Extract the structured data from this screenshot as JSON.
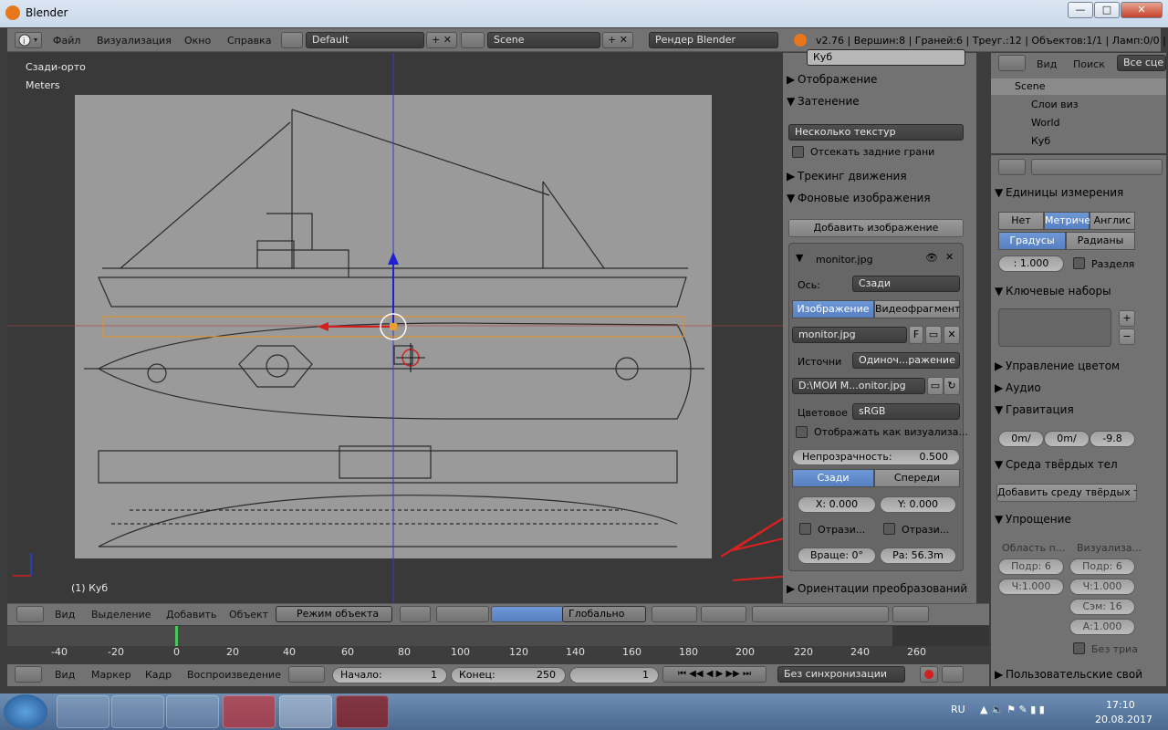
{
  "window": {
    "title": "Blender",
    "min": "—",
    "max": "□",
    "close": "✕"
  },
  "info_header": {
    "menus": [
      "Файл",
      "Визуализация",
      "Окно",
      "Справка"
    ],
    "layout": "Default",
    "scene": "Scene",
    "render_engine": "Рендер Blender",
    "stats": "v2.76 | Вершин:8 | Граней:6 | Треуг.:12 | Объектов:1/1 | Ламп:0/0 | Пам."
  },
  "viewport": {
    "view_name": "Сзади-орто",
    "units": "Meters",
    "object_label": "(1) Куб"
  },
  "viewport_header": {
    "menus": [
      "Вид",
      "Выделение",
      "Добавить",
      "Объект"
    ],
    "mode": "Режим объекта",
    "orientation": "Глобально"
  },
  "timeline": {
    "ticks": [
      "-40",
      "-20",
      "0",
      "20",
      "40",
      "60",
      "80",
      "100",
      "120",
      "140",
      "160",
      "180",
      "200",
      "220",
      "240",
      "260"
    ],
    "menus": [
      "Вид",
      "Маркер",
      "Кадр",
      "Воспроизведение"
    ],
    "start_label": "Начало:",
    "start": "1",
    "end_label": "Конец:",
    "end": "250",
    "current": "1",
    "sync": "Без синхронизации"
  },
  "npanel": {
    "object_name": "Куб",
    "sections": {
      "display": "Отображение",
      "shading": "Затенение",
      "shading_mode": "Несколько текстур",
      "backface": "Отсекать задние грани",
      "motion_tracking": "Трекинг движения",
      "bg_images": "Фоновые изображения",
      "add_image": "Добавить изображение",
      "transform_orient": "Ориентации преобразований"
    },
    "bgimage": {
      "name": "monitor.jpg",
      "axis_label": "Ось:",
      "axis": "Сзади",
      "tab_image": "Изображение",
      "tab_clip": "Видеофрагмент",
      "image_name": "monitor.jpg",
      "fake_user": "F",
      "source_label": "Источни",
      "source": "Одиноч...ражение",
      "path": "D:\\МОИ М...onitor.jpg",
      "color_label": "Цветовое",
      "color_space": "sRGB",
      "show_as_render": "Отображать как визуализа...",
      "opacity": "Непрозрачность:",
      "opacity_value": "0.500",
      "tab_back": "Сзади",
      "tab_front": "Спереди",
      "x": "X:   0.000",
      "y": "Y:   0.000",
      "flip_x": "Отрази...",
      "flip_y": "Отрази...",
      "rotation": "Враще: 0°",
      "size": "Ра: 56.3m"
    }
  },
  "outliner": {
    "menus": [
      "Вид",
      "Поиск"
    ],
    "filter": "Все сце",
    "items": [
      "Scene",
      "Слои виз",
      "World",
      "Куб"
    ]
  },
  "properties": {
    "units_title": "Единицы измерения",
    "unit_none": "Нет",
    "unit_metric": "Метриче",
    "unit_imperial": "Англис",
    "deg": "Градусы",
    "rad": "Радианы",
    "scale": ": 1.000",
    "separate": "Разделя",
    "keying": "Ключевые наборы",
    "color_mgmt": "Управление цветом",
    "audio": "Аудио",
    "gravity": "Гравитация",
    "g_x": "0m/",
    "g_y": "0m/",
    "g_z": "-9.8",
    "rigid": "Среда твёрдых тел",
    "add_rigid": "Добавить среду твёрдых т...",
    "simplify": "Упрощение",
    "vp_area": "Область п...",
    "vp_render": "Визуализа...",
    "sub1": "Подр: 6",
    "sub2": "Подр: 6",
    "ch1": "Ч:1.000",
    "ch2": "Ч:1.000",
    "sam": "Сэм: 16",
    "a": "А:1.000",
    "no_tri": "Без триа",
    "custom": "Пользовательские свой"
  },
  "taskbar": {
    "lang": "RU",
    "time": "17:10",
    "date": "20.08.2017"
  },
  "colors": {
    "accent_blue": "#5680c2",
    "panel": "#727272",
    "viewport": "#393939",
    "annotation_red": "#e02020"
  }
}
